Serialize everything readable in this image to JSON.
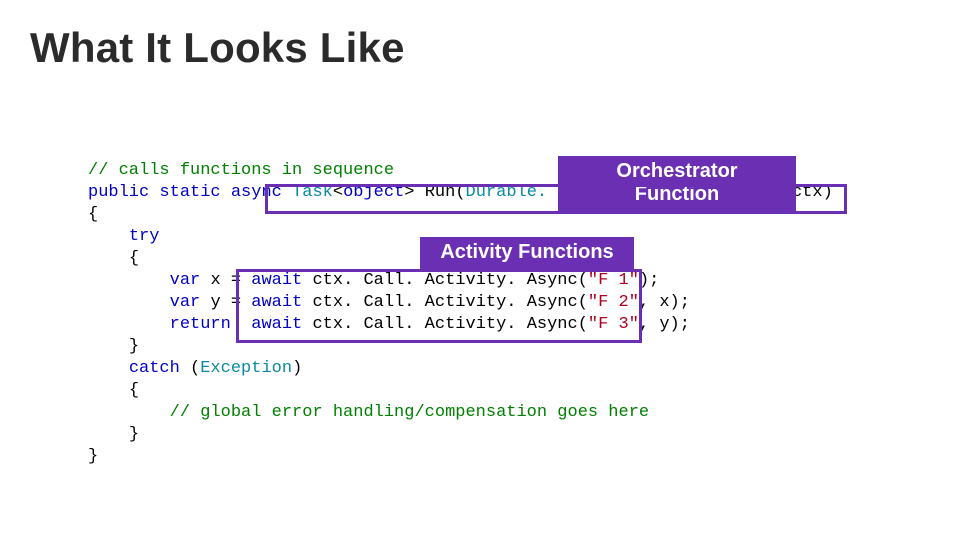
{
  "title": "What It Looks Like",
  "callouts": {
    "orchestrator": "Orchestrator Function",
    "activity": "Activity Functions"
  },
  "code": {
    "line1": "// calls functions in sequence",
    "kw_public": "public",
    "kw_static": "static",
    "kw_async": "async",
    "type_task": "Task",
    "kw_object": "object",
    "m_run": "Run",
    "type_ctx": "Durable. Orchestration. Context",
    "p_ctx": "ctx",
    "kw_try": "try",
    "kw_var": "var",
    "v_x": "x",
    "v_y": "y",
    "kw_await": "await",
    "ctx_call": "ctx. Call. Activity. Async",
    "s_f1": "\"F 1\"",
    "s_f2": "\"F 2\"",
    "s_f3": "\"F 3\"",
    "kw_return": "return",
    "kw_catch": "catch",
    "type_ex": "Exception",
    "line_comment2": "// global error handling/compensation goes here"
  }
}
